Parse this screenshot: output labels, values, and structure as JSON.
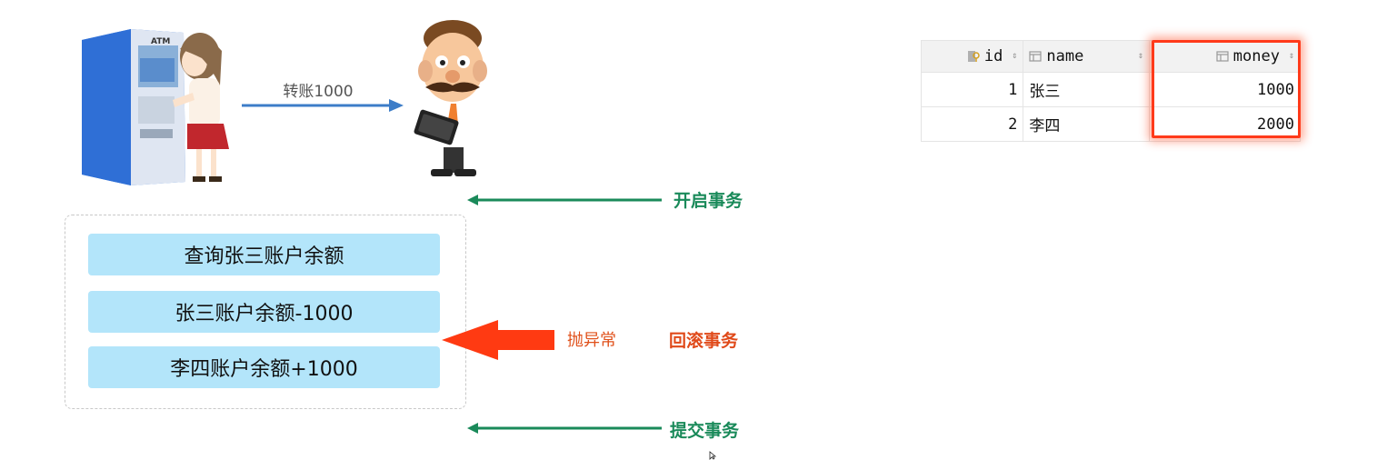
{
  "transfer": {
    "label": "转账1000"
  },
  "steps": {
    "begin": "开启事务",
    "exception": "抛异常",
    "rollback": "回滚事务",
    "commit": "提交事务"
  },
  "operations": [
    "查询张三账户余额",
    "张三账户余额-1000",
    "李四账户余额+1000"
  ],
  "atm": {
    "sign": "ATM"
  },
  "table": {
    "columns": [
      "id",
      "name",
      "money"
    ],
    "rows": [
      {
        "id": "1",
        "name": "张三",
        "money": "1000"
      },
      {
        "id": "2",
        "name": "李四",
        "money": "2000"
      }
    ]
  },
  "colors": {
    "green": "#1a8a5a",
    "red": "#ff3a1a",
    "op_bg": "#b3e5fa",
    "arrow_blue": "#3d7dc8"
  }
}
